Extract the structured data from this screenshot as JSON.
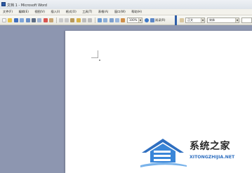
{
  "window": {
    "title": "文档 1 - Microsoft Word"
  },
  "menu": [
    "文件(F)",
    "编辑(E)",
    "视图(V)",
    "插入(I)",
    "格式(O)",
    "工具(T)",
    "表格(A)",
    "窗口(W)",
    "帮助(H)"
  ],
  "toolbar": {
    "zoom": "100%",
    "read_label": "阅读(R)",
    "style": "正文",
    "font": "宋体"
  },
  "watermark": {
    "title": "系统之家",
    "domain": "XITONGZHIJIA.NET",
    "colors": {
      "brand_blue": "#2f6fc0",
      "text": "#2a2a2a"
    }
  },
  "colors": {
    "workspace": "#8d96b0",
    "page": "#ffffff",
    "accent": "#2f5ea8"
  }
}
